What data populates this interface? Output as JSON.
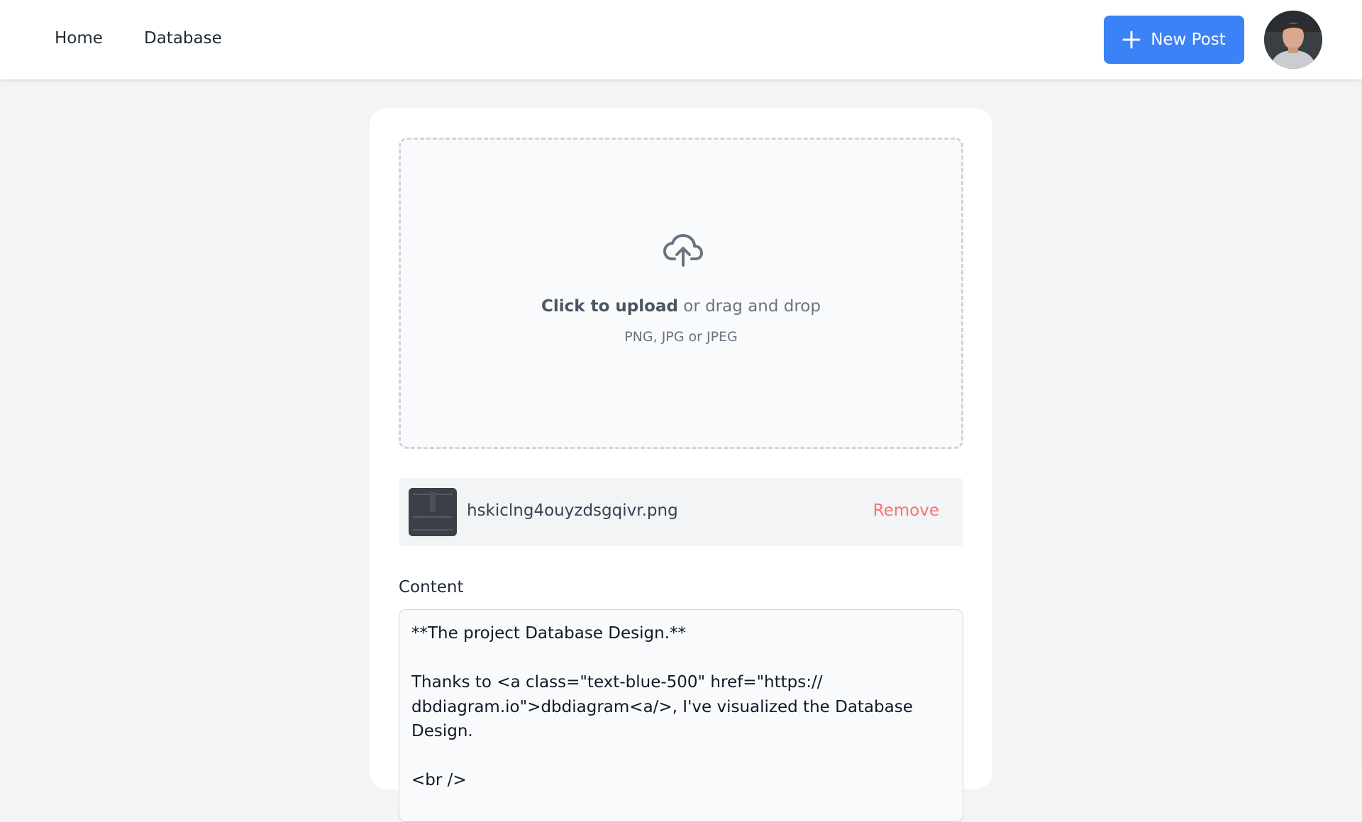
{
  "nav": {
    "links": [
      {
        "label": "Home"
      },
      {
        "label": "Database"
      }
    ],
    "new_post_label": "New Post"
  },
  "upload": {
    "cta_bold": "Click to upload",
    "cta_rest": " or drag and drop",
    "hint": "PNG, JPG or JPEG"
  },
  "file": {
    "name": "hskiclng4ouyzdsgqivr.png",
    "remove_label": "Remove"
  },
  "content": {
    "label": "Content",
    "lines": [
      "**The project Database Design.**",
      "",
      "Thanks to <a class=\"text-blue-500\" href=\"https://",
      "dbdiagram.io\">dbdiagram<a/>, I've visualized the Database Design.",
      "",
      "<br />"
    ]
  },
  "colors": {
    "primary": "#3b82f6",
    "remove": "#f87171",
    "page_bg": "#f3f4f6"
  },
  "icons": {
    "upload": "cloud-upload-icon",
    "new_post": "plus-icon"
  }
}
